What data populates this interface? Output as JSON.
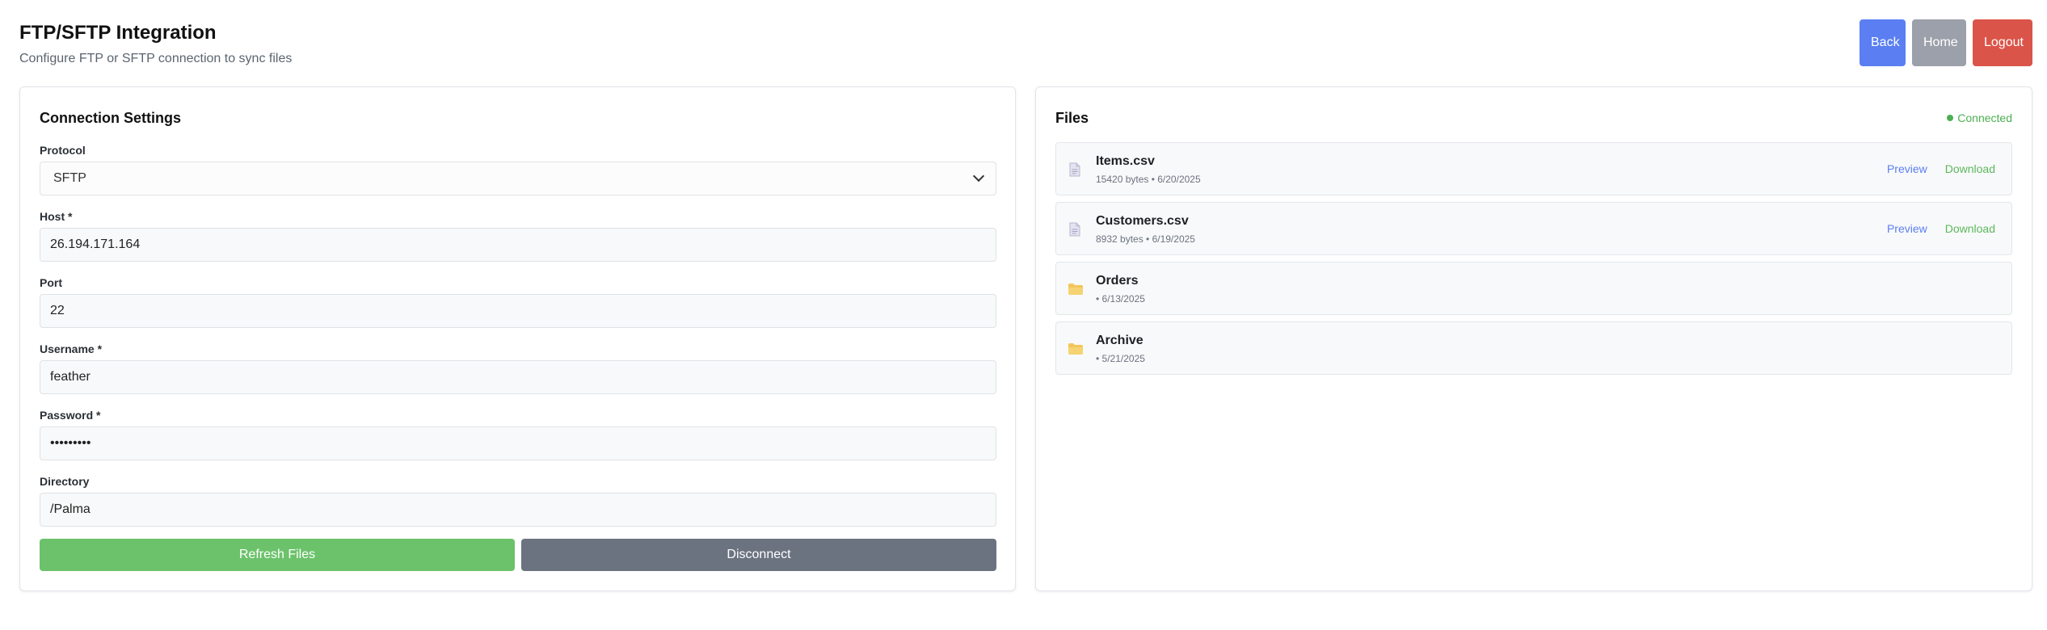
{
  "header": {
    "title": "FTP/SFTP Integration",
    "subtitle": "Configure FTP or SFTP connection to sync files"
  },
  "nav": {
    "back_label": "Back",
    "home_label": "Home",
    "logout_label": "Logout"
  },
  "colors": {
    "back": "#5b7ff2",
    "home": "#9ca0aa",
    "logout": "#db5449",
    "refresh": "#6bc26a",
    "disconnect": "#6c7380",
    "connected": "#4caf50"
  },
  "connection": {
    "title": "Connection Settings",
    "protocol_label": "Protocol",
    "protocol_value": "SFTP",
    "host_label": "Host *",
    "host_value": "26.194.171.164",
    "port_label": "Port",
    "port_value": "22",
    "username_label": "Username *",
    "username_value": "feather",
    "password_label": "Password *",
    "password_value": "•••••••••",
    "directory_label": "Directory",
    "directory_value": "/Palma",
    "refresh_label": "Refresh Files",
    "disconnect_label": "Disconnect"
  },
  "files": {
    "title": "Files",
    "status": "Connected",
    "preview_label": "Preview",
    "download_label": "Download",
    "items": [
      {
        "name": "Items.csv",
        "meta": "15420 bytes • 6/20/2025",
        "type": "file-icon"
      },
      {
        "name": "Customers.csv",
        "meta": "8932 bytes • 6/19/2025",
        "type": "file-icon"
      },
      {
        "name": "Orders",
        "meta": "• 6/13/2025",
        "type": "folder-icon"
      },
      {
        "name": "Archive",
        "meta": "• 5/21/2025",
        "type": "folder-icon"
      }
    ]
  }
}
